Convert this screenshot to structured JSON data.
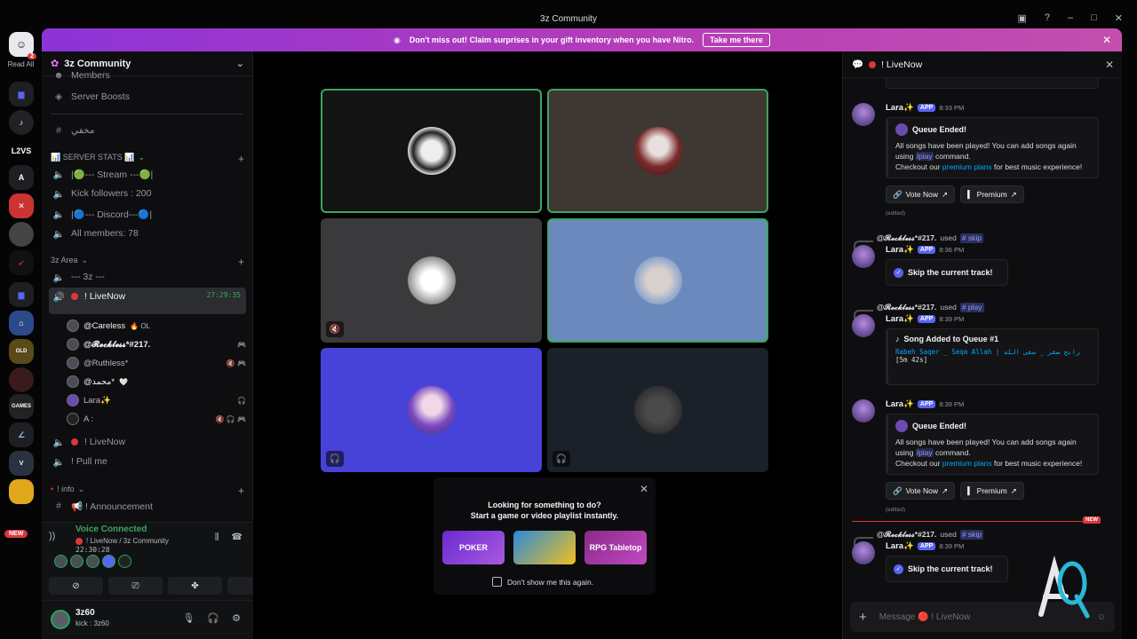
{
  "window": {
    "title": "3z Community"
  },
  "rail": {
    "read_all": "Read All",
    "home_badge": "2",
    "text_servers": [
      "L2VS",
      "A"
    ],
    "new_label": "NEW"
  },
  "banner": {
    "text": "Don't miss out! Claim surprises in your gift inventory when you have Nitro.",
    "button": "Take me there"
  },
  "sidebar": {
    "server_name": "3z Community",
    "items_top": [
      {
        "label": "Members",
        "icon": "people-icon"
      },
      {
        "label": "Server Boosts",
        "icon": "boost-icon"
      },
      {
        "label": "مخفي",
        "icon": "hash-icon"
      }
    ],
    "category_stats": "📊 SERVER STATS 📊",
    "stats_channels": [
      "|🟢--- Stream ---🟢|",
      "Kick followers : 200",
      "|🔵--- Discord---🔵|",
      "All members: 78"
    ],
    "category_3z": "3z Area",
    "channels_3z": [
      {
        "label": "--- 3z ---"
      },
      {
        "label": "! LiveNow",
        "timer": "27:29:35"
      }
    ],
    "voice_users": [
      {
        "name": "@Careless",
        "extra": "🔥 OL"
      },
      {
        "name": "@𝓡𝓮𝓬𝓴𝓵𝓮𝓼𝓼*#217.",
        "extra": "🎮"
      },
      {
        "name": "@Ruthless*",
        "extra": "🔇 🎮"
      },
      {
        "name": "@محمد*",
        "extra": "🤍"
      },
      {
        "name": "Lara✨",
        "extra": "🎧"
      },
      {
        "name": "A :",
        "extra": "🔇 🎧 🎮"
      }
    ],
    "channels_after": [
      {
        "label": "! LiveNow"
      },
      {
        "label": "! Pull me"
      }
    ],
    "category_info": "! info",
    "info_channels": [
      {
        "label": "📢 ! Announcement"
      }
    ]
  },
  "voice_panel": {
    "status": "Voice Connected",
    "channel": "! LiveNow / 3z Community",
    "time": "22:30:28"
  },
  "user_panel": {
    "name": "3z60",
    "status": "kick : 3z60"
  },
  "activity_popup": {
    "line1": "Looking for something to do?",
    "line2": "Start a game or video playlist instantly.",
    "games": [
      "POKER",
      "",
      "RPG Tabletop"
    ],
    "checkbox_label": "Don't show me this again."
  },
  "chat": {
    "channel": "! LiveNow",
    "composer_placeholder": "Message 🔴 ! LiveNow",
    "messages": [
      {
        "author": "Lara✨",
        "tag": "APP",
        "time": "8:33 PM",
        "embed_title": "Queue Ended!",
        "body_1": "All songs have been played! You can add songs again",
        "body_2a": "using ",
        "cmd": "/play",
        "body_2b": " command.",
        "body_3a": "Checkout our ",
        "link": "premium plans",
        "body_3b": " for best music experience!",
        "btn_vote": "Vote Now",
        "btn_premium": "Premium",
        "edited": "(edited)"
      },
      {
        "reply_user": "@𝓡𝓮𝓬𝓴𝓵𝓮𝓼𝓼*#217.",
        "reply_used": "used",
        "reply_cmd": "# skip",
        "author": "Lara✨",
        "tag": "APP",
        "time": "8:36 PM",
        "box": "Skip the current track!"
      },
      {
        "reply_user": "@𝓡𝓮𝓬𝓴𝓵𝓮𝓼𝓼*#217.",
        "reply_used": "used",
        "reply_cmd": "# play",
        "author": "Lara✨",
        "tag": "APP",
        "time": "8:39 PM",
        "embed_title": "Song Added to Queue #1",
        "song": "Rabeh Saqer _ Seqa Allah | رابح صقر _ سقى الله",
        "duration": "[5m 42s]"
      },
      {
        "author": "Lara✨",
        "tag": "APP",
        "time": "8:39 PM",
        "embed_title": "Queue Ended!",
        "body_1": "All songs have been played! You can add songs again",
        "body_2a": "using ",
        "cmd": "/play",
        "body_2b": " command.",
        "body_3a": "Checkout our ",
        "link": "premium plans",
        "body_3b": " for best music experience!",
        "btn_vote": "Vote Now",
        "btn_premium": "Premium",
        "edited": "(edited)"
      },
      {
        "reply_user": "@𝓡𝓮𝓬𝓴𝓵𝓮𝓼𝓼*#217.",
        "reply_used": "used",
        "reply_cmd": "# skip",
        "author": "Lara✨",
        "tag": "APP",
        "time": "8:39 PM",
        "box": "Skip the current track!"
      }
    ],
    "new_tag": "NEW"
  },
  "colors": {
    "accent": "#5865f2",
    "voice_green": "#23a55a",
    "live_red": "#da373c",
    "nitro_gradient_start": "#8c34d8",
    "nitro_gradient_end": "#c34fae"
  }
}
